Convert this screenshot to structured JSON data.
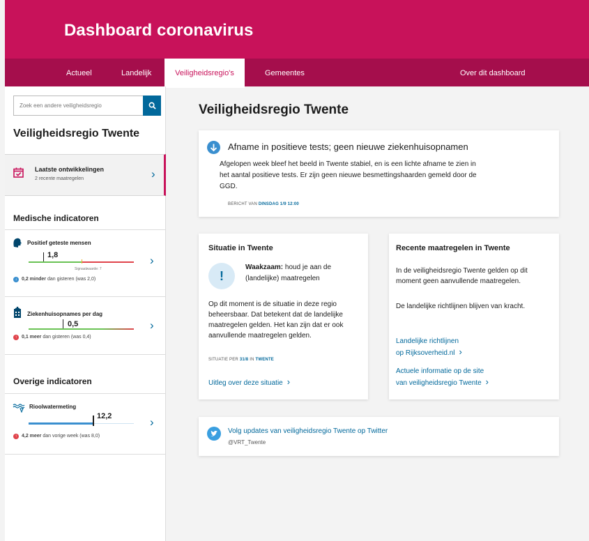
{
  "header": {
    "title": "Dashboard coronavirus"
  },
  "nav": {
    "items": [
      {
        "label": "Actueel"
      },
      {
        "label": "Landelijk"
      },
      {
        "label": "Veiligheidsregio's"
      },
      {
        "label": "Gemeentes"
      },
      {
        "label": "Over dit dashboard"
      }
    ]
  },
  "sidebar": {
    "search_placeholder": "Zoek een andere veiligheidsregio",
    "region_title": "Veiligheidsregio Twente",
    "developments": {
      "title": "Laatste ontwikkelingen",
      "subtitle": "2 recente maatregelen"
    },
    "medical_heading": "Medische indicatoren",
    "indicators": [
      {
        "title": "Positief geteste mensen",
        "value": "1,8",
        "signal_label": "Signaalwaarde: 7",
        "change_bold": "0,2 minder",
        "change_rest": "dan gisteren (was 2,0)",
        "direction": "down"
      },
      {
        "title": "Ziekenhuisopnames per dag",
        "value": "0,5",
        "change_bold": "0,1 meer",
        "change_rest": "dan gisteren (was 0,4)",
        "direction": "up"
      }
    ],
    "other_heading": "Overige indicatoren",
    "sewage": {
      "title": "Rioolwatermeting",
      "value": "12,2",
      "change_bold": "4,2 meer",
      "change_rest": "dan vorige week (was 8,0)",
      "direction": "up"
    }
  },
  "main": {
    "title": "Veiligheidsregio Twente",
    "alert": {
      "title": "Afname in positieve tests; geen nieuwe ziekenhuisopnamen",
      "body": "Afgelopen week bleef het beeld in Twente stabiel, en is een lichte afname te zien in het aantal positieve tests. Er zijn geen nieuwe besmettingshaarden gemeld door de GGD.",
      "meta_prefix": "Bericht van",
      "meta_date": "Dinsdag 1/9 12:00"
    },
    "situation": {
      "title": "Situatie in Twente",
      "warning_bold": "Waakzaam:",
      "warning_rest": " houd je aan de (landelijke) maatregelen",
      "body": "Op dit moment is de situatie in deze regio beheersbaar. Dat betekent dat de landelijke maatregelen gelden. Het kan zijn dat er ook aanvullende maatregelen gelden.",
      "meta_prefix": "Situatie per",
      "meta_date": "31/8",
      "meta_in": "in",
      "meta_region": "Twente",
      "link": "Uitleg over deze situatie"
    },
    "measures": {
      "title": "Recente maatregelen in Twente",
      "body1": "In de veiligheidsregio Twente gelden op dit moment geen aanvullende maatregelen.",
      "body2": "De landelijke richtlijnen blijven van kracht.",
      "link1_line1": "Landelijke richtlijnen",
      "link1_line2": "op Rijksoverheid.nl",
      "link2_line1": "Actuele informatie op de site",
      "link2_line2": "van veiligheidsregio Twente"
    },
    "twitter": {
      "text": "Volg updates van veiligheidsregio Twente op Twitter",
      "handle": "@VRT_Twente"
    }
  },
  "colors": {
    "brand": "#c8125a",
    "nav": "#a50e4c",
    "link": "#01689b",
    "up": "#e0434b",
    "down": "#3a8fcf",
    "bar_green": "#69c253",
    "bar_red": "#e0434b",
    "bar_blue": "#3a8fcf"
  }
}
